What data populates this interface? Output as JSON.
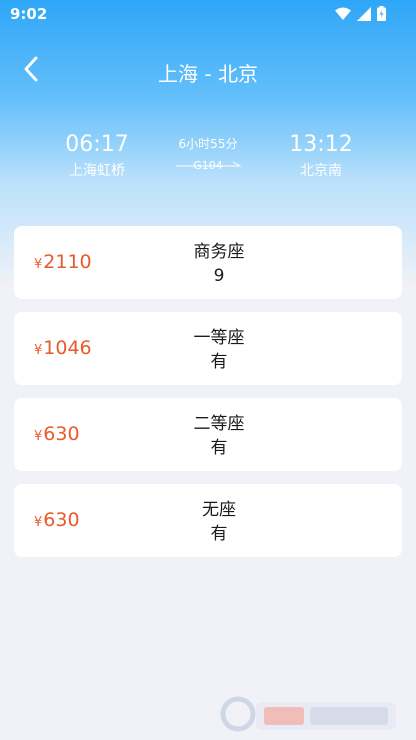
{
  "status_bar": {
    "time": "9:02",
    "icons": [
      "wifi-icon",
      "signal-icon",
      "battery-icon"
    ]
  },
  "header": {
    "back_icon": "chevron-left-icon",
    "title": "上海 - 北京"
  },
  "trip": {
    "departure_time": "06:17",
    "departure_station": "上海虹桥",
    "duration": "6小时55分",
    "train_number": "G104",
    "arrival_time": "13:12",
    "arrival_station": "北京南"
  },
  "seats": [
    {
      "currency": "¥",
      "price": "2110",
      "type": "商务座",
      "availability": "9"
    },
    {
      "currency": "¥",
      "price": "1046",
      "type": "一等座",
      "availability": "有"
    },
    {
      "currency": "¥",
      "price": "630",
      "type": "二等座",
      "availability": "有"
    },
    {
      "currency": "¥",
      "price": "630",
      "type": "无座",
      "availability": "有"
    }
  ],
  "colors": {
    "header_blue": "#2ea6f8",
    "price_orange": "#e85a2b",
    "background": "#f1f2f7",
    "card": "#ffffff"
  }
}
